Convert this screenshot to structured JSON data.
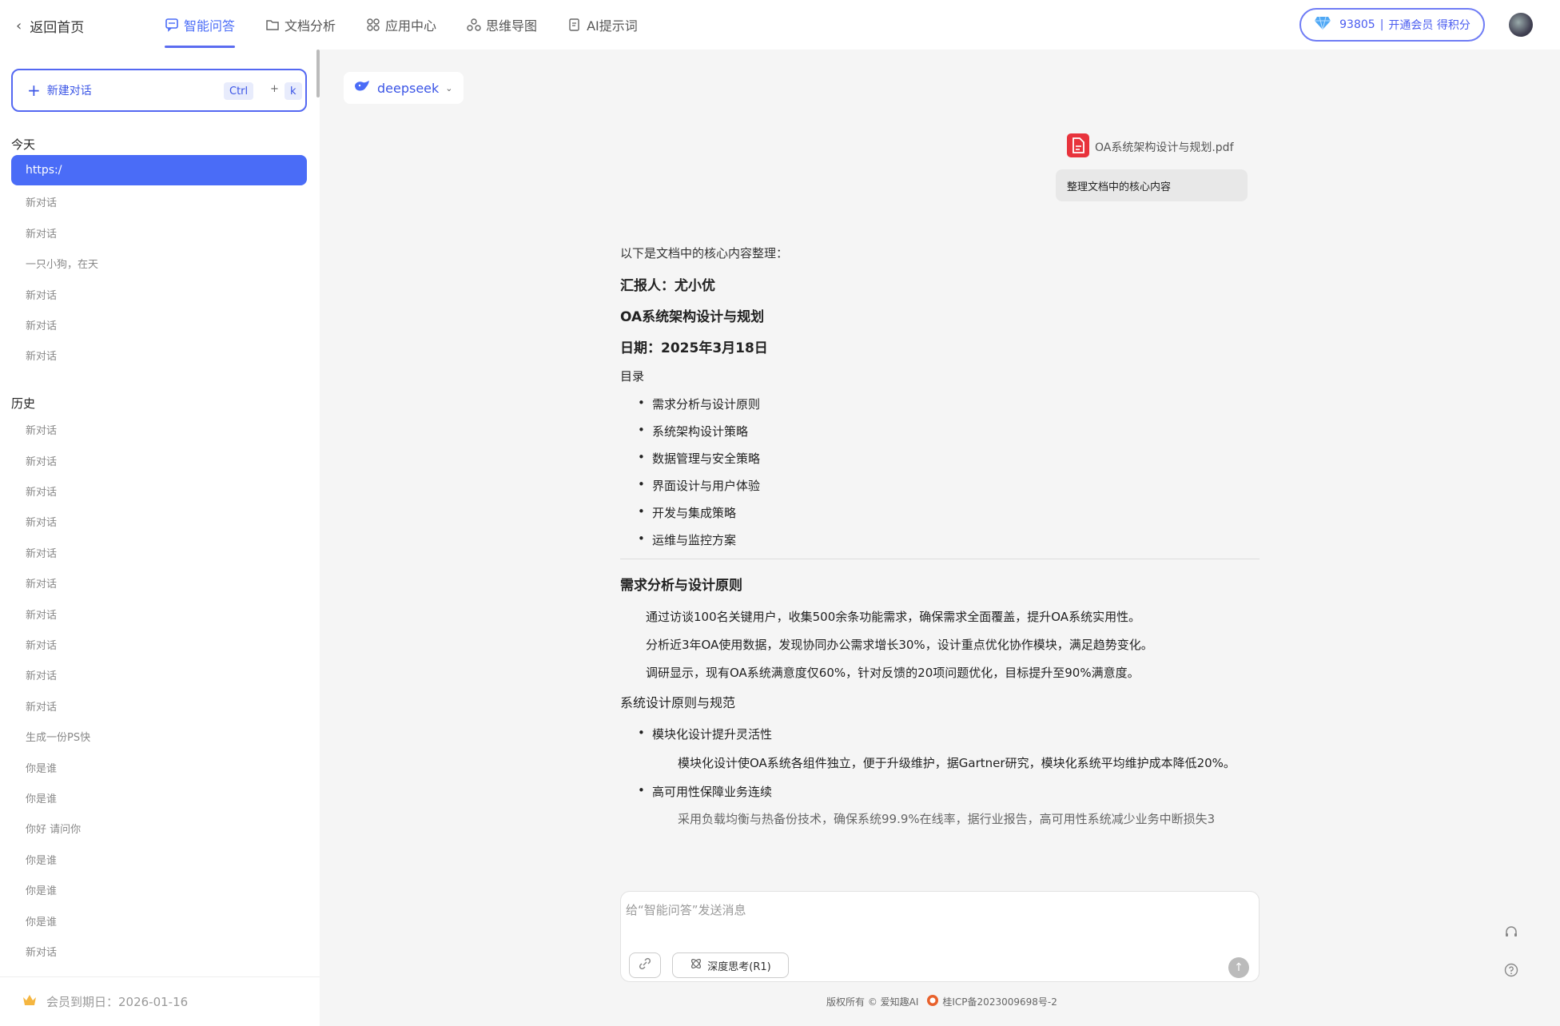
{
  "header": {
    "back_label": "返回首页",
    "tabs": [
      {
        "label": "智能问答",
        "icon": "chat-icon",
        "active": true
      },
      {
        "label": "文档分析",
        "icon": "folder-icon",
        "active": false
      },
      {
        "label": "应用中心",
        "icon": "apps-icon",
        "active": false
      },
      {
        "label": "思维导图",
        "icon": "mindmap-icon",
        "active": false
      },
      {
        "label": "AI提示词",
        "icon": "prompt-icon",
        "active": false
      }
    ],
    "points": "93805",
    "divider": "|",
    "member_cta": "开通会员 得积分",
    "accent_color": "#4a6cf7"
  },
  "sidebar": {
    "new_chat_label": "新建对话",
    "shortcut_ctrl": "Ctrl",
    "shortcut_plus": "+",
    "shortcut_key": "k",
    "today_title": "今天",
    "today_items": [
      "https:/",
      "新对话",
      "新对话",
      "一只小狗，在天",
      "新对话",
      "新对话",
      "新对话"
    ],
    "history_title": "历史",
    "history_items": [
      "新对话",
      "新对话",
      "新对话",
      "新对话",
      "新对话",
      "新对话",
      "新对话",
      "新对话",
      "新对话",
      "新对话",
      "生成一份PS快",
      "你是谁",
      "你是谁",
      "你好 请问你",
      "你是谁",
      "你是谁",
      "你是谁",
      "新对话"
    ],
    "membership_expiry": "会员到期日：2026-01-16"
  },
  "main": {
    "model_name": "deepseek",
    "file_name": "OA系统架构设计与规划.pdf",
    "user_message": "整理文档中的核心内容",
    "answer": {
      "intro": "以下是文档中的核心内容整理：",
      "reporter": "汇报人：尤小优",
      "doc_title": "OA系统架构设计与规划",
      "date": "日期：2025年3月18日",
      "toc_title": "目录",
      "toc": [
        "需求分析与设计原则",
        "系统架构设计策略",
        "数据管理与安全策略",
        "界面设计与用户体验",
        "开发与集成策略",
        "运维与监控方案"
      ],
      "section1_title": "需求分析与设计原则",
      "section1_paras": [
        "通过访谈100名关键用户，收集500余条功能需求，确保需求全面覆盖，提升OA系统实用性。",
        "分析近3年OA使用数据，发现协同办公需求增长30%，设计重点优化协作模块，满足趋势变化。",
        "调研显示，现有OA系统满意度仅60%，针对反馈的20项问题优化，目标提升至90%满意度。"
      ],
      "subsection_title": "系统设计原则与规范",
      "bullet1": "模块化设计提升灵活性",
      "bullet1_desc": "模块化设计使OA系统各组件独立，便于升级维护，据Gartner研究，模块化系统平均维护成本降低20%。",
      "bullet2": "高可用性保障业务连续",
      "bullet2_desc_cut": "采用负载均衡与热备份技术，确保系统99.9%在线率，据行业报告，高可用性系统减少业务中断损失3"
    },
    "input_placeholder": "给“智能问答”发送消息",
    "deep_think_label": "深度思考(R1)",
    "footer_copyright": "版权所有 © 爱知趣AI",
    "footer_icp": "桂ICP备2023009698号-2"
  }
}
